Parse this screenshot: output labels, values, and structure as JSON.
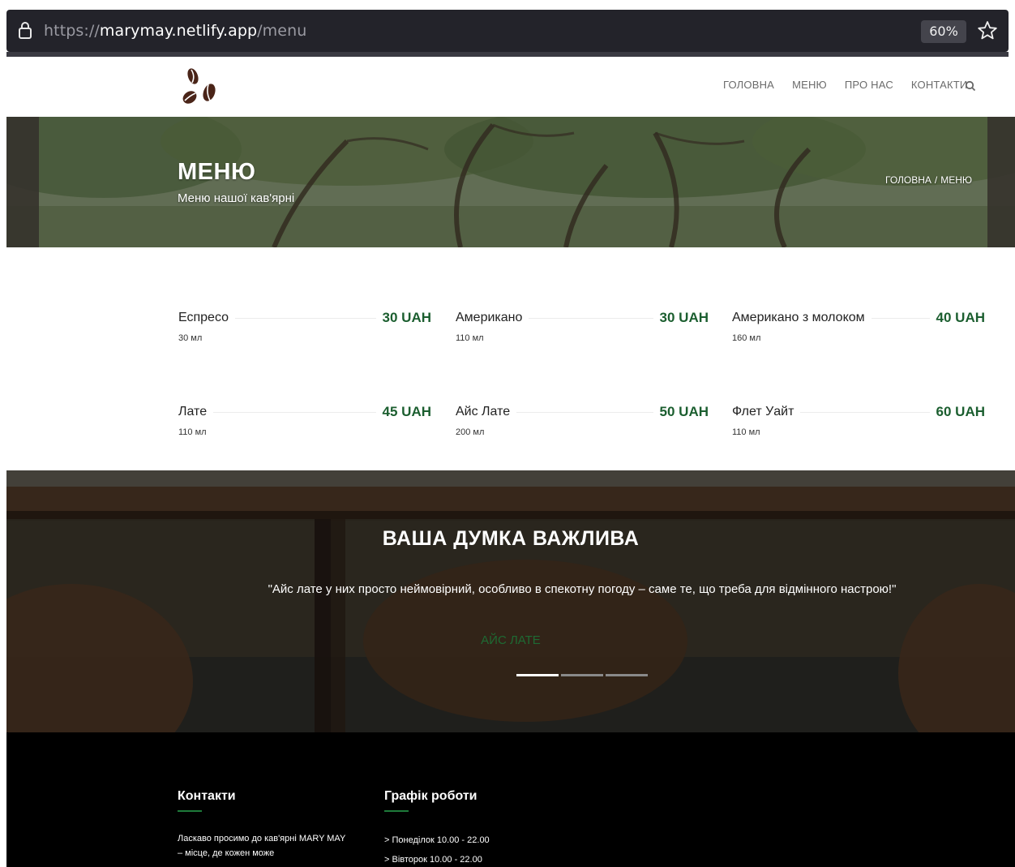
{
  "browser": {
    "url_scheme": "https://",
    "url_host": "marymay.netlify.app",
    "url_path": "/menu",
    "zoom": "60%"
  },
  "nav": {
    "items": [
      "ГОЛОВНА",
      "МЕНЮ",
      "ПРО НАС",
      "КОНТАКТИ"
    ]
  },
  "hero": {
    "title": "МЕНЮ",
    "subtitle": "Меню нашої кав'ярні",
    "breadcrumb_home": "ГОЛОВНА",
    "breadcrumb_sep": "/",
    "breadcrumb_current": "МЕНЮ"
  },
  "menu": {
    "items": [
      {
        "name": "Еспресо",
        "price": "30 UAH",
        "volume": "30 мл"
      },
      {
        "name": "Американо",
        "price": "30 UAH",
        "volume": "110 мл"
      },
      {
        "name": "Американо з молоком",
        "price": "40 UAH",
        "volume": "160 мл"
      },
      {
        "name": "Лате",
        "price": "45 UAH",
        "volume": "110 мл"
      },
      {
        "name": "Айс Лате",
        "price": "50 UAH",
        "volume": "200 мл"
      },
      {
        "name": "Флет Уайт",
        "price": "60 UAH",
        "volume": "110 мл"
      }
    ]
  },
  "testimonial": {
    "title": "ВАША ДУМКА ВАЖЛИВА",
    "quote": "\"Айс лате у них просто неймовірний, особливо в спекотну погоду – саме те, що треба для відмінного настрою!\"",
    "author": "АЙС ЛАТЕ",
    "slides_total": 3,
    "active_slide": 1
  },
  "footer": {
    "contacts_heading": "Контакти",
    "contacts_text": "Ласкаво просимо до кав'ярні MARY MAY – місце, де кожен може",
    "schedule_heading": "Графік роботи",
    "schedule": [
      "> Понеділок 10.00 - 22.00",
      "> Вівторок 10.00 - 22.00"
    ]
  },
  "colors": {
    "accent_green": "#1b5e2f",
    "logo_brown": "#4a2418",
    "footer_bg": "#000000"
  }
}
